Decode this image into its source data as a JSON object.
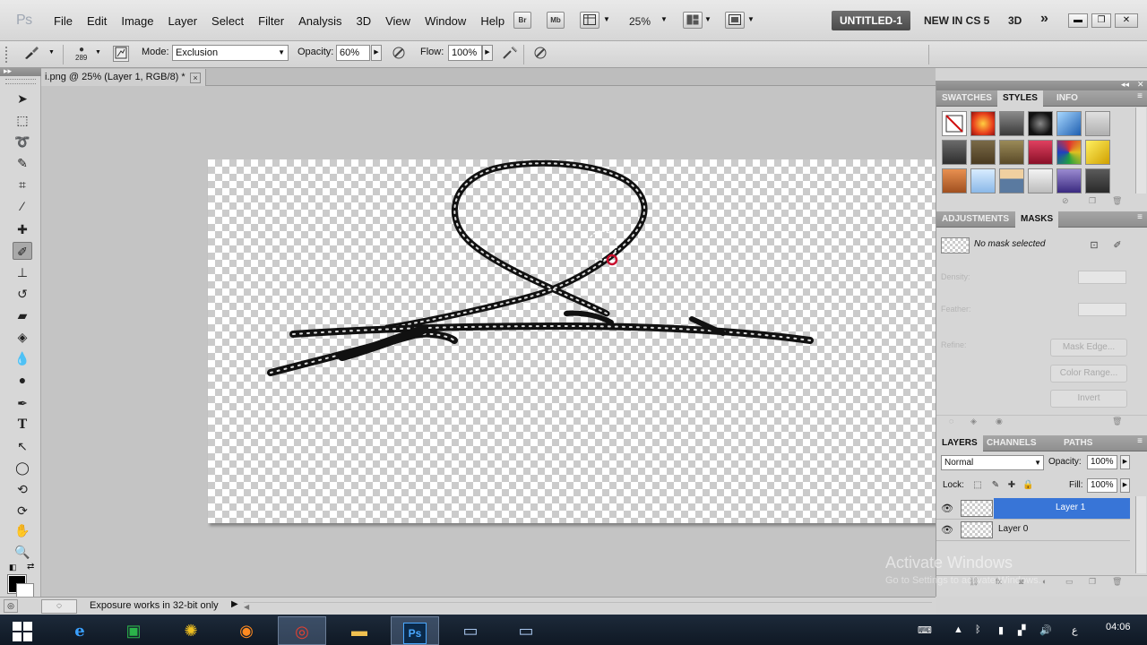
{
  "app": {
    "logo": "Ps"
  },
  "menu": [
    "File",
    "Edit",
    "Image",
    "Layer",
    "Select",
    "Filter",
    "Analysis",
    "3D",
    "View",
    "Window",
    "Help"
  ],
  "appbar": {
    "bridge": "Br",
    "minibridge": "Mb",
    "zoom": "25%",
    "workspaces": [
      "UNTITLED-1",
      "NEW IN CS 5",
      "3D"
    ],
    "more": "»"
  },
  "options": {
    "brush_size": "289",
    "mode_label": "Mode:",
    "mode_value": "Exclusion",
    "opacity_label": "Opacity:",
    "opacity_value": "60%",
    "flow_label": "Flow:",
    "flow_value": "100%"
  },
  "document": {
    "tab_title": "i.png @ 25% (Layer 1, RGB/8) *",
    "close": "×"
  },
  "status": {
    "zoom": "",
    "message": "Exposure works in 32-bit only"
  },
  "panels": {
    "top_tabs": [
      "SWATCHES",
      "STYLES",
      "INFO"
    ],
    "active_top_tab": "STYLES",
    "styles": [
      "#ffffff",
      "#e8401c",
      "#5a5a5a",
      "#2b2b2b",
      "#3a78c2",
      "#c9c9c9",
      "#4d4d4d",
      "#6a5a3a",
      "#7a6a40",
      "#b3203a",
      "#d9c020",
      "#e8e020",
      "#c87a3a",
      "#a8c8e8",
      "#8aa0b8",
      "#e0e0e0",
      "#6a5aa0",
      "#4a4a4a"
    ],
    "adj_tabs": [
      "ADJUSTMENTS",
      "MASKS"
    ],
    "mask_status": "No mask selected",
    "density_label": "Density:",
    "feather_label": "Feather:",
    "refine_label": "Refine:",
    "mask_edge": "Mask Edge...",
    "color_range": "Color Range...",
    "invert": "Invert",
    "layer_tabs": [
      "LAYERS",
      "CHANNELS",
      "PATHS"
    ],
    "blend_mode": "Normal",
    "opacity_label": "Opacity:",
    "opacity_value": "100%",
    "lock_label": "Lock:",
    "fill_label": "Fill:",
    "fill_value": "100%",
    "layers": [
      {
        "name": "Layer 1",
        "selected": true
      },
      {
        "name": "Layer 0",
        "selected": false
      }
    ]
  },
  "watermark": {
    "line1": "Activate Windows",
    "line2": "Go to Settings to activate Windows."
  },
  "taskbar": {
    "time": "04:06",
    "locale": "ع"
  },
  "colors": {
    "selection": "#3875d7",
    "menubar": "#e0e0e0",
    "workspace": "#c4c4c4",
    "taskbar": "#15202e"
  }
}
